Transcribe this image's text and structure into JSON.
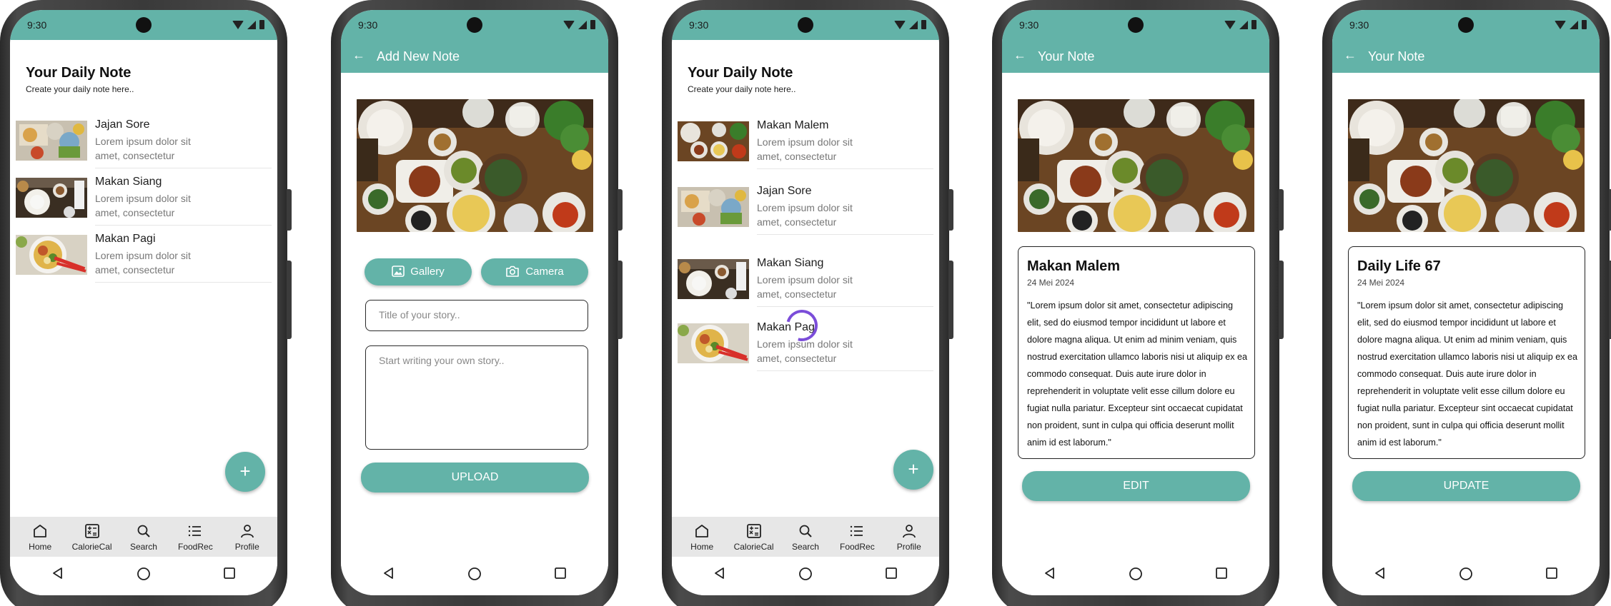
{
  "status": {
    "time": "9:30"
  },
  "screen1": {
    "title": "Your Daily Note",
    "subtitle": "Create your daily note here..",
    "items": [
      {
        "name": "Jajan Sore",
        "desc": "Lorem ipsum dolor sit amet, consectetur"
      },
      {
        "name": "Makan Siang",
        "desc": "Lorem ipsum dolor sit amet, consectetur"
      },
      {
        "name": "Makan Pagi",
        "desc": "Lorem ipsum dolor sit amet, consectetur"
      }
    ],
    "fab": "+"
  },
  "screen2": {
    "back": "←",
    "appbar_title": "Add New Note",
    "gallery_label": "Gallery",
    "camera_label": "Camera",
    "title_placeholder": "Title of your story..",
    "story_placeholder": "Start writing your own story..",
    "upload_label": "UPLOAD"
  },
  "screen3": {
    "title": "Your Daily Note",
    "subtitle": "Create your daily note here..",
    "items": [
      {
        "name": "Makan Malem",
        "desc": "Lorem ipsum dolor sit amet, consectetur"
      },
      {
        "name": "Jajan Sore",
        "desc": "Lorem ipsum dolor sit amet, consectetur"
      },
      {
        "name": "Makan Siang",
        "desc": "Lorem ipsum dolor sit amet, consectetur"
      },
      {
        "name": "Makan Pagi",
        "desc": "Lorem ipsum dolor sit amet, consectetur"
      }
    ],
    "fab": "+"
  },
  "screen4": {
    "back": "←",
    "appbar_title": "Your Note",
    "note_title": "Makan Malem",
    "note_date": "24 Mei 2024",
    "note_body": "\"Lorem ipsum dolor sit amet, consectetur adipiscing elit, sed do eiusmod tempor incididunt ut labore et dolore magna aliqua. Ut enim ad minim veniam, quis nostrud exercitation ullamco laboris nisi ut aliquip ex ea commodo consequat. Duis aute irure dolor in reprehenderit in voluptate velit esse cillum dolore eu fugiat nulla pariatur. Excepteur sint occaecat cupidatat non proident, sunt in culpa qui officia deserunt mollit anim id est laborum.\"",
    "button_label": "EDIT"
  },
  "screen5": {
    "back": "←",
    "appbar_title": "Your Note",
    "note_title": "Daily Life 67",
    "note_date": "24 Mei 2024",
    "note_body": "\"Lorem ipsum dolor sit amet, consectetur adipiscing elit, sed do eiusmod tempor incididunt ut labore et dolore magna aliqua. Ut enim ad minim veniam, quis nostrud exercitation ullamco laboris nisi ut aliquip ex ea commodo consequat. Duis aute irure dolor in reprehenderit in voluptate velit esse cillum dolore eu fugiat nulla pariatur. Excepteur sint occaecat cupidatat non proident, sunt in culpa qui officia deserunt mollit anim id est laborum.\"",
    "button_label": "UPDATE"
  },
  "nav": {
    "home": "Home",
    "caloriecal": "CalorieCal",
    "search": "Search",
    "foodrec": "FoodRec",
    "profile": "Profile"
  },
  "colors": {
    "primary": "#63b3a8",
    "spinner": "#7b4dd9",
    "navbar": "#e7e7e7"
  }
}
